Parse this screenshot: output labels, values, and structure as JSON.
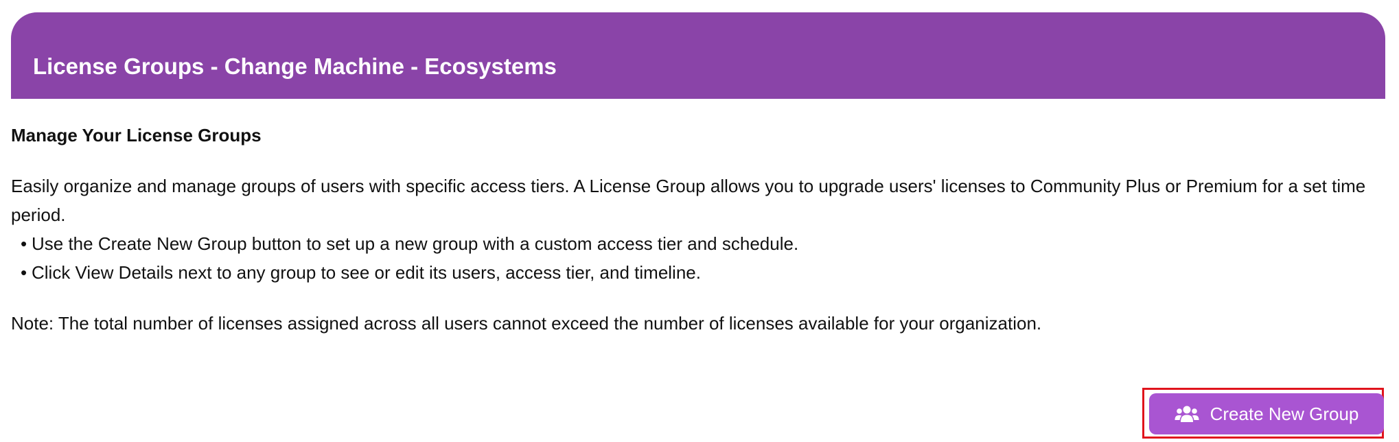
{
  "header": {
    "title": "License Groups - Change Machine - Ecosystems"
  },
  "content": {
    "heading": "Manage Your License Groups",
    "description": "Easily organize and manage groups of users with specific access tiers. A License Group allows you to upgrade users' licenses to Community Plus or Premium for a set time period.",
    "bullets": [
      "Use the Create New Group button to set up a new group with a custom access tier and schedule.",
      "Click View Details next to any group to see or edit its users, access tier, and timeline."
    ],
    "note": "Note: The total number of licenses assigned across all users cannot exceed the number of licenses available for your organization."
  },
  "actions": {
    "create_label": "Create New Group",
    "create_icon": "users-icon"
  },
  "colors": {
    "header_bg": "#8a44a8",
    "button_bg": "#a955d2",
    "focus_outline": "#e0141c"
  }
}
